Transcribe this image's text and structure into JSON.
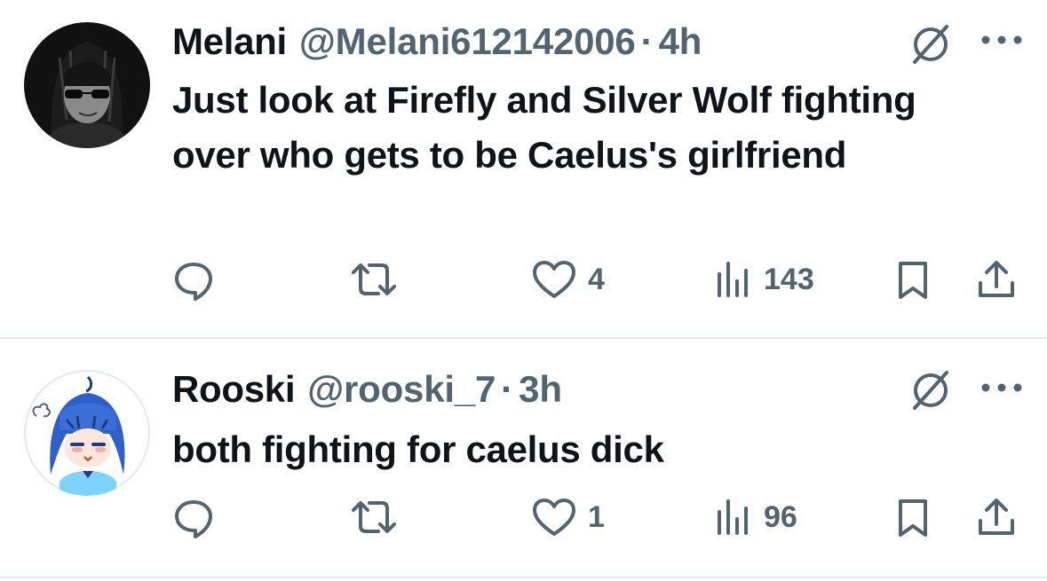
{
  "tweets": [
    {
      "name": "Melani",
      "handle": "@Melani612142006",
      "separator": "·",
      "time": "4h",
      "text": "Just look at Firefly and Silver Wolf fighting over who gets to be Caelus's girlfriend",
      "likes": "4",
      "views": "143",
      "avatar": "dark-haired-sunglasses-avatar"
    },
    {
      "name": "Rooski",
      "handle": "@rooski_7",
      "separator": "·",
      "time": "3h",
      "text": "both fighting for caelus dick",
      "likes": "1",
      "views": "96",
      "avatar": "blue-haired-anime-girl-avatar"
    }
  ],
  "icons": {
    "reply": "speech-bubble-icon",
    "retweet": "retweet-arrows-icon",
    "like": "heart-icon",
    "views": "bar-chart-icon",
    "bookmark": "bookmark-icon",
    "share": "share-upload-icon",
    "grok": "grok-slash-circle-icon",
    "more": "ellipsis-icon"
  },
  "colors": {
    "text_primary": "#0f1419",
    "text_secondary": "#536471",
    "divider": "#e5e8eb",
    "background": "#ffffff"
  }
}
